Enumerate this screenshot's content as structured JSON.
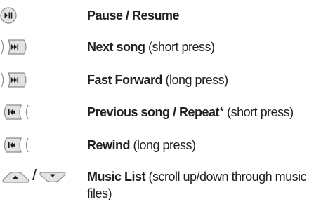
{
  "controls": [
    {
      "icon": "play-pause-icon",
      "bold": "Pause / Resume",
      "normal": ""
    },
    {
      "icon": "next-track-icon",
      "bold": "Next song",
      "normal": " (short press)"
    },
    {
      "icon": "next-track-icon",
      "bold": "Fast Forward",
      "normal": " (long press)"
    },
    {
      "icon": "previous-track-icon",
      "bold": "Previous song / Repeat",
      "normal": "* (short press)"
    },
    {
      "icon": "previous-track-icon",
      "bold": "Rewind",
      "normal": " (long press)"
    },
    {
      "icon": "up-down-keys-icon",
      "bold": "Music List",
      "normal": " (scroll up/down through music files)",
      "separator": "/"
    }
  ],
  "colors": {
    "text": "#231f20",
    "key_fill": "#e2e3e4",
    "key_stroke": "#8a8c8e",
    "glyph": "#231f20"
  }
}
